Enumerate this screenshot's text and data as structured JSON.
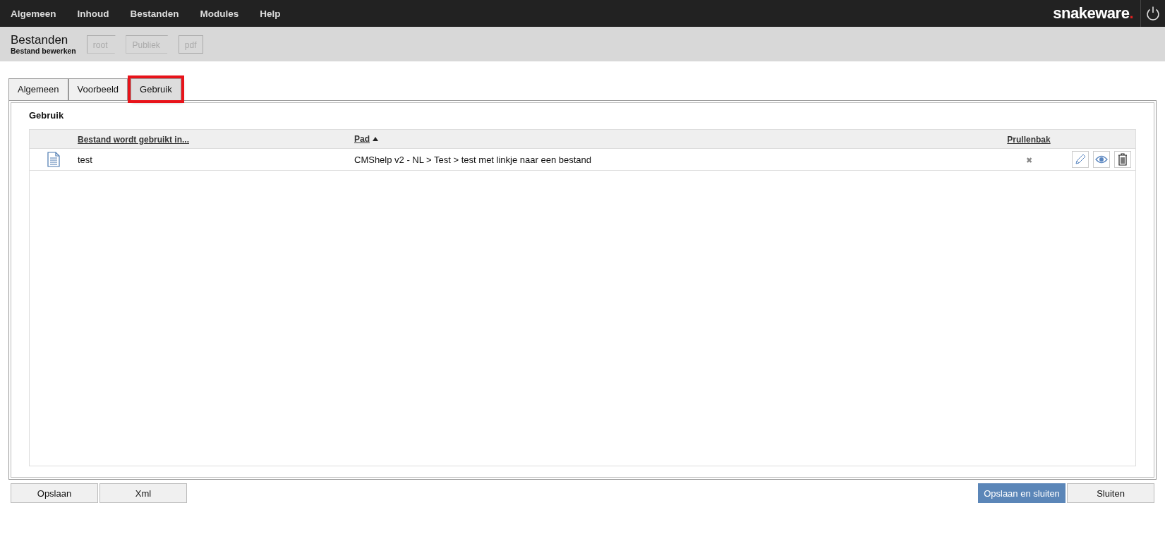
{
  "menu": [
    "Algemeen",
    "Inhoud",
    "Bestanden",
    "Modules",
    "Help"
  ],
  "logo": {
    "text": "snakeware",
    "dot": "."
  },
  "header": {
    "title": "Bestanden",
    "subtitle": "Bestand bewerken",
    "breadcrumb": [
      "root",
      "Publiek",
      "pdf"
    ]
  },
  "tabs": [
    {
      "label": "Algemeen",
      "selected": false,
      "highlighted": false
    },
    {
      "label": "Voorbeeld",
      "selected": false,
      "highlighted": false
    },
    {
      "label": "Gebruik",
      "selected": true,
      "highlighted": true
    }
  ],
  "section_title": "Gebruik",
  "table": {
    "columns": [
      {
        "label": "Bestand wordt gebruikt in...",
        "sorted": false
      },
      {
        "label": "Pad",
        "sorted": true
      },
      {
        "label": "Prullenbak",
        "sorted": false
      }
    ],
    "rows": [
      {
        "name": "test",
        "path": "CMShelp v2 - NL > Test > test met linkje naar een bestand",
        "trash": "✖"
      }
    ]
  },
  "buttons_left": [
    {
      "label": "Opslaan",
      "primary": false
    },
    {
      "label": "Xml",
      "primary": false
    }
  ],
  "buttons_right": [
    {
      "label": "Opslaan en sluiten",
      "primary": true
    },
    {
      "label": "Sluiten",
      "primary": false
    }
  ]
}
